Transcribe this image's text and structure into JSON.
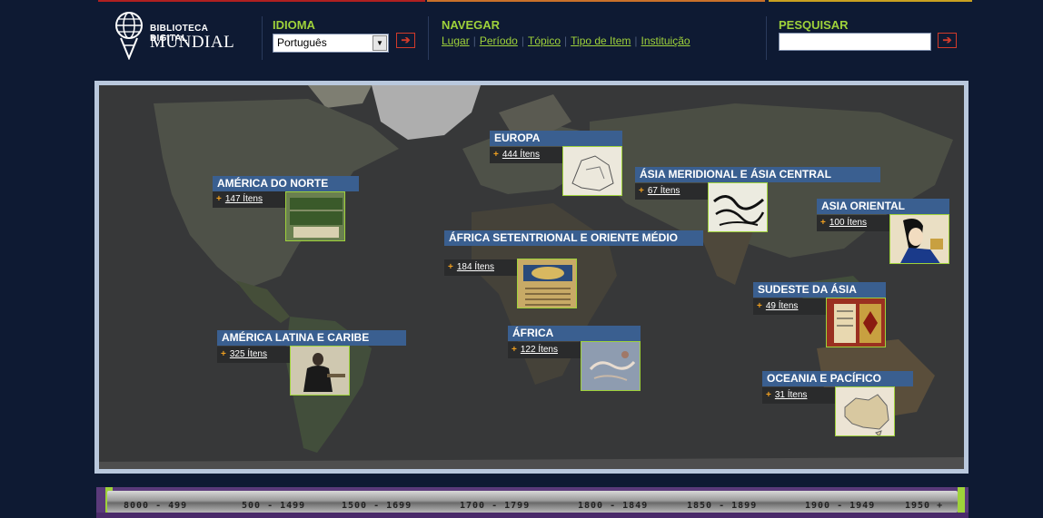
{
  "header": {
    "logo_line1": "BIBLIOTECA DIGITAL",
    "logo_line2": "MUNDIAL",
    "language": {
      "title": "IDIOMA",
      "selected": "Português"
    },
    "browse": {
      "title": "NAVEGAR",
      "links": [
        "Lugar",
        "Período",
        "Tópico",
        "Tipo de Item",
        "Instituição"
      ]
    },
    "search": {
      "title": "PESQUISAR",
      "value": ""
    },
    "go_glyph": "➔"
  },
  "regions": [
    {
      "name": "AMÉRICA DO NORTE",
      "count": "147 Ítens"
    },
    {
      "name": "EUROPA",
      "count": "444 Ítens"
    },
    {
      "name": "ÁSIA MERIDIONAL E ÁSIA CENTRAL",
      "count": "67 Ítens"
    },
    {
      "name": "ASIA ORIENTAL",
      "count": "100 Ítens"
    },
    {
      "name": "ÁFRICA SETENTRIONAL E ORIENTE MÉDIO",
      "count": "184 Ítens"
    },
    {
      "name": "SUDESTE DA ÁSIA",
      "count": "49 Ítens"
    },
    {
      "name": "AMÉRICA LATINA E CARIBE",
      "count": "325 Ítens"
    },
    {
      "name": "ÁFRICA",
      "count": "122 Ítens"
    },
    {
      "name": "OCEANIA E PACÍFICO",
      "count": "31 Ítens"
    }
  ],
  "timeline": {
    "periods": [
      "8000 - 499",
      "500 - 1499",
      "1500 - 1699",
      "1700 - 1799",
      "1800 - 1849",
      "1850 - 1899",
      "1900 - 1949",
      "1950 +"
    ]
  },
  "colors": {
    "accent_green": "#9fd23a",
    "region_blue": "#3a5f90",
    "background": "#0e1a33",
    "go_red": "#d23a2a"
  }
}
